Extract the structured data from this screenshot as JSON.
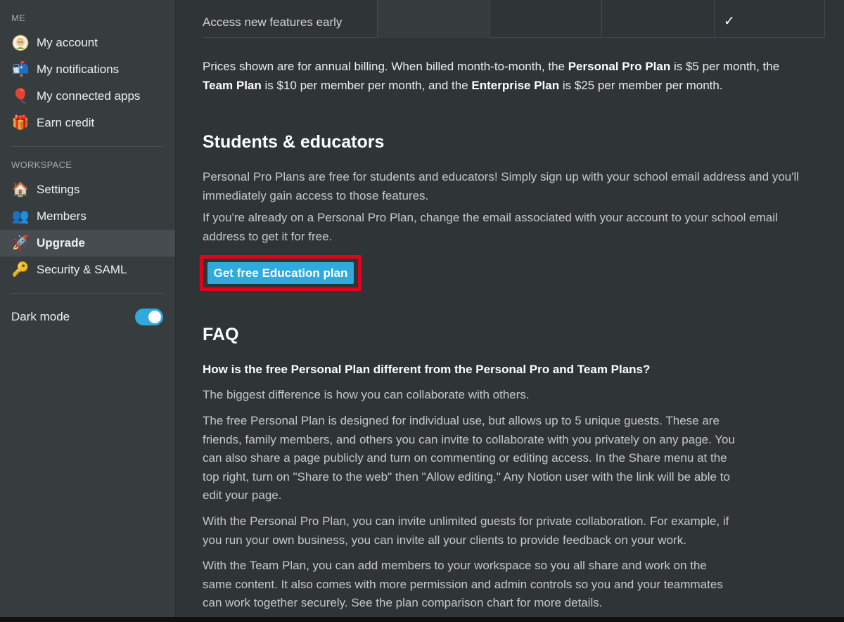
{
  "sidebar": {
    "me_title": "ME",
    "me_items": [
      {
        "label": "My account",
        "icon": "avatar-icon"
      },
      {
        "label": "My notifications",
        "icon": "mailbox-icon"
      },
      {
        "label": "My connected apps",
        "icon": "balloon-icon"
      },
      {
        "label": "Earn credit",
        "icon": "gift-icon"
      }
    ],
    "workspace_title": "WORKSPACE",
    "workspace_items": [
      {
        "label": "Settings",
        "icon": "house-icon"
      },
      {
        "label": "Members",
        "icon": "people-icon"
      },
      {
        "label": "Upgrade",
        "icon": "rocket-icon",
        "active": true
      },
      {
        "label": "Security & SAML",
        "icon": "key-icon"
      }
    ],
    "dark_mode_label": "Dark mode",
    "dark_mode_on": true
  },
  "table": {
    "row_label": "Access new features early",
    "check": "✓"
  },
  "pricing_note": {
    "p1": "Prices shown are for annual billing. When billed month-to-month, the ",
    "b1": "Personal Pro Plan",
    "p2": " is $5 per month, the ",
    "b2": "Team Plan",
    "p3": " is $10 per member per month, and the ",
    "b3": "Enterprise Plan",
    "p4": " is $25 per member per month."
  },
  "students": {
    "heading": "Students & educators",
    "para1": "Personal Pro Plans are free for students and educators! Simply sign up with your school email address and you'll immediately gain access to those features.",
    "para2": "If you're already on a Personal Pro Plan, change the email associated with your account to your school email address to get it for free.",
    "button": "Get free Education plan"
  },
  "faq": {
    "heading": "FAQ",
    "question": "How is the free Personal Plan different from the Personal Pro and Team Plans?",
    "answers": [
      "The biggest difference is how you can collaborate with others.",
      "The free Personal Plan is designed for individual use, but allows up to 5 unique guests. These are friends, family members, and others you can invite to collaborate with you privately on any page. You can also share a page publicly and turn on commenting or editing access. In the Share menu at the top right, turn on \"Share to the web\" then \"Allow editing.\" Any Notion user with the link will be able to edit your page.",
      "With the Personal Pro Plan, you can invite unlimited guests for private collaboration. For example, if you run your own business, you can invite all your clients to provide feedback on your work.",
      "With the Team Plan, you can add members to your workspace so you all share and work on the same content. It also comes with more permission and admin controls so you and your teammates can work together securely. See the plan comparison chart for more details."
    ]
  }
}
